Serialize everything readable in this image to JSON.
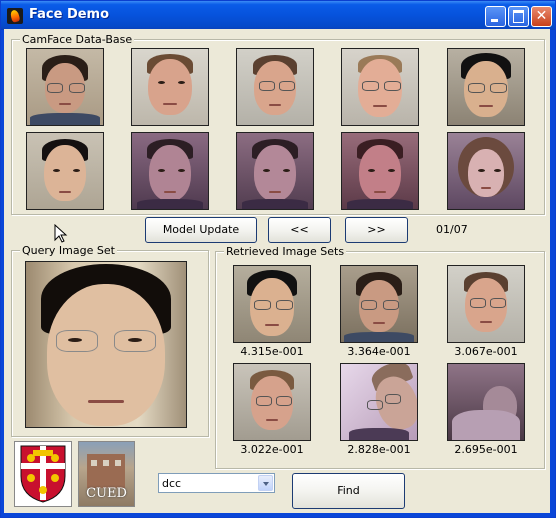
{
  "window": {
    "title": "Face Demo"
  },
  "database": {
    "title": "CamFace Data-Base",
    "prev_label": "<<",
    "next_label": ">>",
    "update_label": "Model Update",
    "page": "01/07"
  },
  "query": {
    "title": "Query Image Set"
  },
  "retrieved": {
    "title": "Retrieved Image Sets",
    "scores": [
      "4.315e-001",
      "3.364e-001",
      "3.067e-001",
      "3.022e-001",
      "2.828e-001",
      "2.695e-001"
    ]
  },
  "logos": {
    "cued_text": "CUED"
  },
  "method": {
    "selected": "dcc"
  },
  "find": {
    "label": "Find"
  }
}
